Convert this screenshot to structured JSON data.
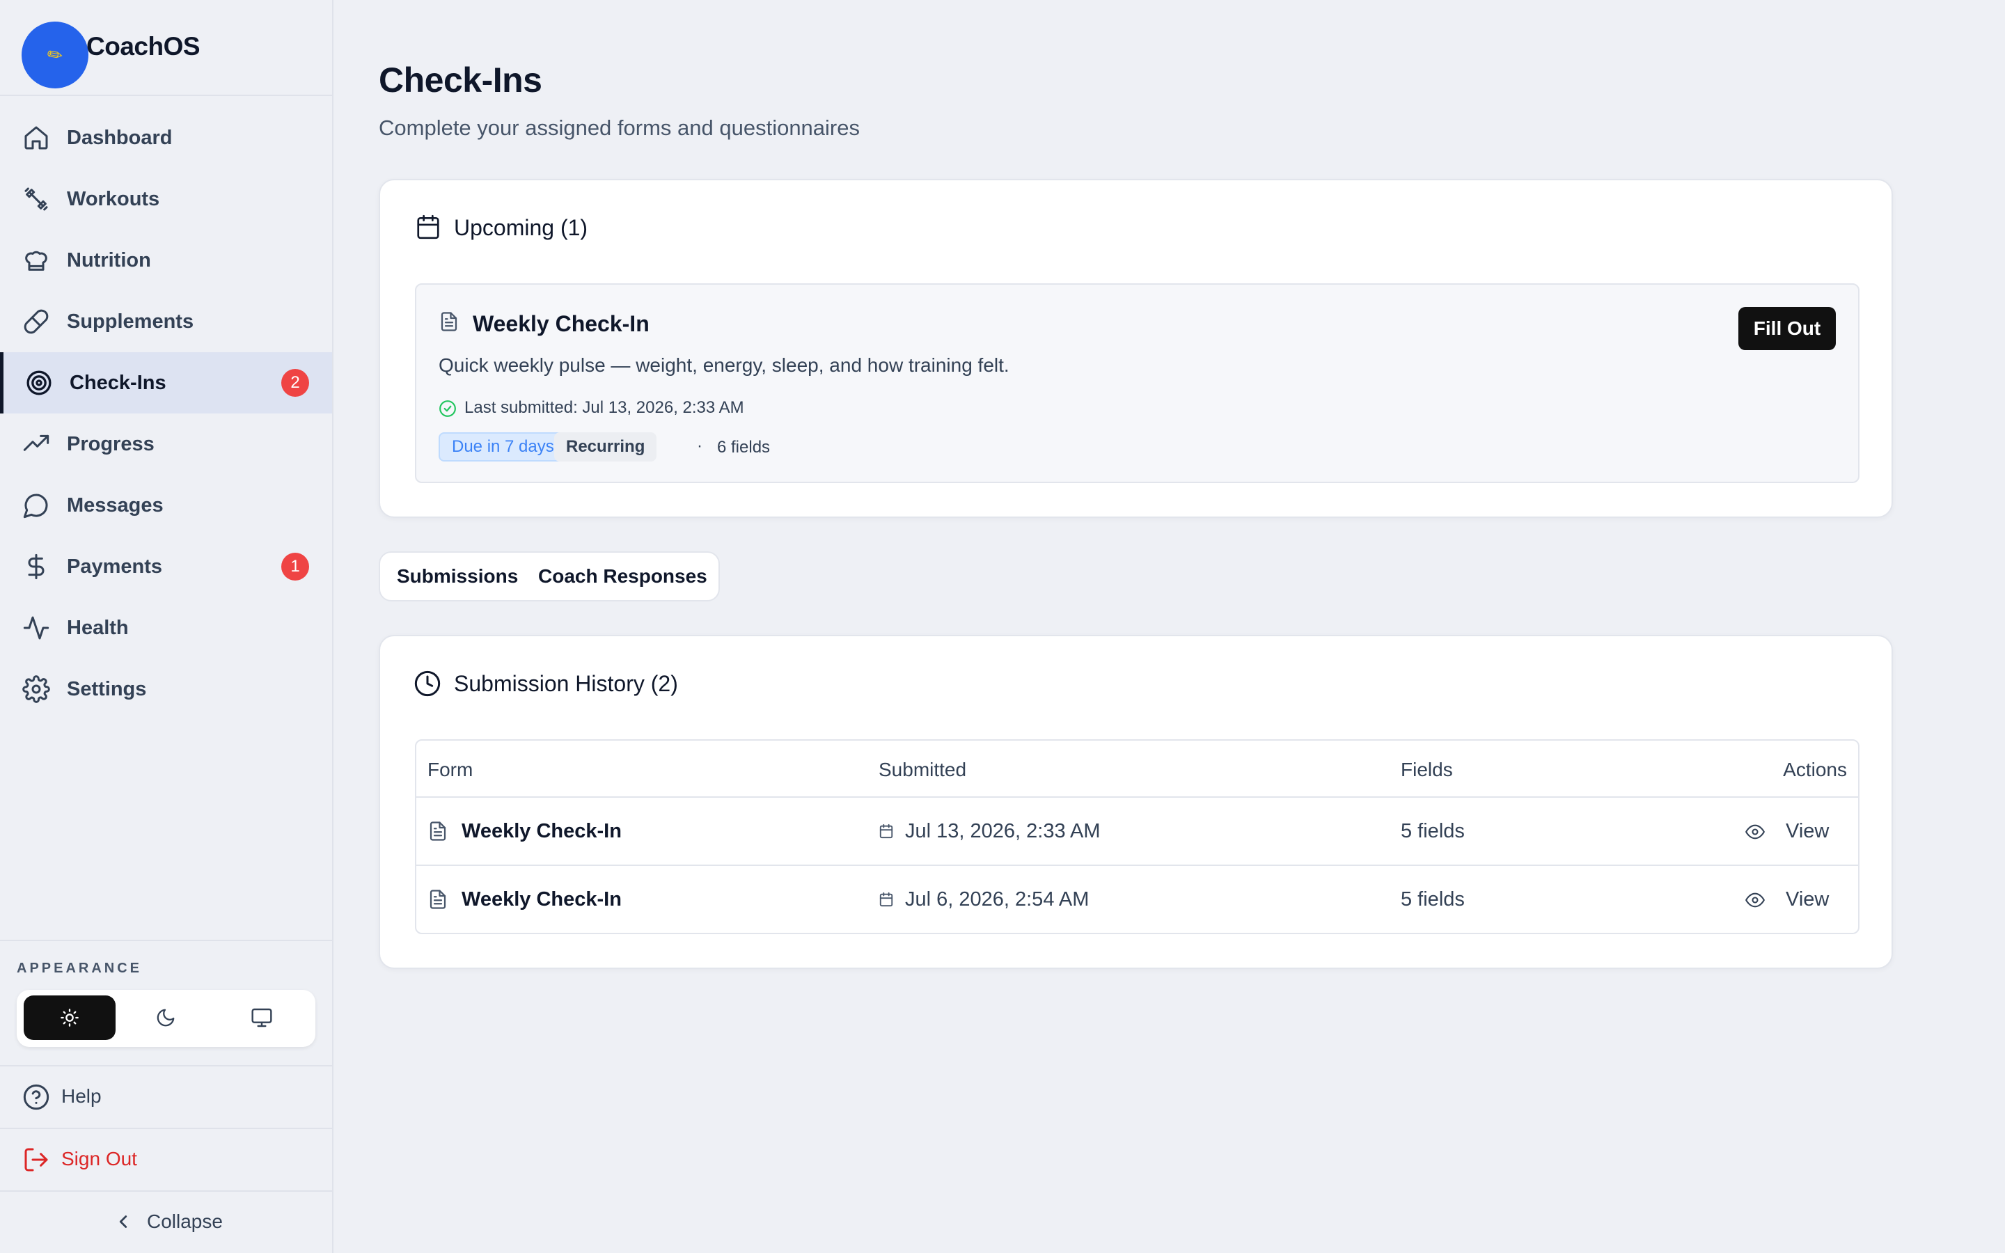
{
  "app": {
    "name": "CoachOS"
  },
  "sidebar": {
    "items": [
      {
        "label": "Dashboard",
        "icon": "home-icon"
      },
      {
        "label": "Workouts",
        "icon": "dumbbell-icon"
      },
      {
        "label": "Nutrition",
        "icon": "chef-hat-icon"
      },
      {
        "label": "Supplements",
        "icon": "pill-icon"
      },
      {
        "label": "Check-Ins",
        "icon": "target-icon",
        "active": true,
        "badge": "2"
      },
      {
        "label": "Progress",
        "icon": "trending-up-icon"
      },
      {
        "label": "Messages",
        "icon": "message-circle-icon"
      },
      {
        "label": "Payments",
        "icon": "dollar-icon",
        "badge": "1"
      },
      {
        "label": "Health",
        "icon": "activity-icon"
      },
      {
        "label": "Settings",
        "icon": "gear-icon"
      }
    ],
    "appearance_label": "APPEARANCE",
    "theme_options": [
      "light",
      "dark",
      "system"
    ],
    "theme_selected": "light",
    "help_label": "Help",
    "signout_label": "Sign Out",
    "collapse_label": "Collapse"
  },
  "page": {
    "title": "Check-Ins",
    "subtitle": "Complete your assigned forms and questionnaires"
  },
  "upcoming": {
    "title": "Upcoming (1)",
    "form": {
      "name": "Weekly Check-In",
      "description": "Quick weekly pulse — weight, energy, sleep, and how training felt.",
      "last_submitted": "Last submitted: Jul 13, 2026, 2:33 AM",
      "due": "Due in 7 days",
      "recurrence": "Recurring",
      "separator": "·",
      "fields": "6 fields",
      "action": "Fill Out"
    }
  },
  "tabs": [
    {
      "label": "Submissions"
    },
    {
      "label": "Coach Responses"
    }
  ],
  "history": {
    "title": "Submission History (2)",
    "columns": [
      "Form",
      "Submitted",
      "Fields",
      "Actions"
    ],
    "rows": [
      {
        "form": "Weekly Check-In",
        "submitted": "Jul 13, 2026, 2:33 AM",
        "fields": "5 fields",
        "action": "View"
      },
      {
        "form": "Weekly Check-In",
        "submitted": "Jul 6, 2026, 2:54 AM",
        "fields": "5 fields",
        "action": "View"
      }
    ]
  },
  "colors": {
    "accent_blue": "#2563eb",
    "badge_red": "#ef4444",
    "signout_red": "#dc2626",
    "success_green": "#22c55e",
    "due_pill_bg": "#dbeafe",
    "due_pill_text": "#3b82f6"
  }
}
